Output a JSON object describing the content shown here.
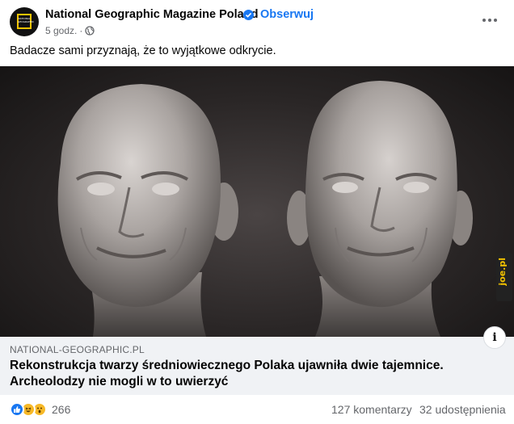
{
  "post": {
    "page_name": "National Geographic Magazine Poland",
    "separator": "·",
    "follow_label": "Obserwuj",
    "time": "5 godz.",
    "time_separator": "·",
    "audience_icon": "globe-icon",
    "more_icon": "more-options-icon",
    "caption": "Badacze sami przyznają, że to wyjątkowe odkrycie.",
    "avatar_logo_text": "NATIONAL GEOGRAPHIC",
    "accent_color": "#1877f2",
    "brand_yellow": "#f3c400"
  },
  "image": {
    "watermark": "joe.pl"
  },
  "link_preview": {
    "domain": "NATIONAL-GEOGRAPHIC.PL",
    "headline": "Rekonstrukcja twarzy średniowiecznego Polaka ujawniła dwie tajemnice. Archeolodzy nie mogli w to uwierzyć",
    "info_icon": "info-icon",
    "info_label": "i"
  },
  "engagement": {
    "reaction_icons": [
      "like-icon",
      "haha-icon",
      "wow-icon"
    ],
    "reaction_count": "266",
    "comments": "127 komentarzy",
    "shares": "32 udostępnienia"
  }
}
